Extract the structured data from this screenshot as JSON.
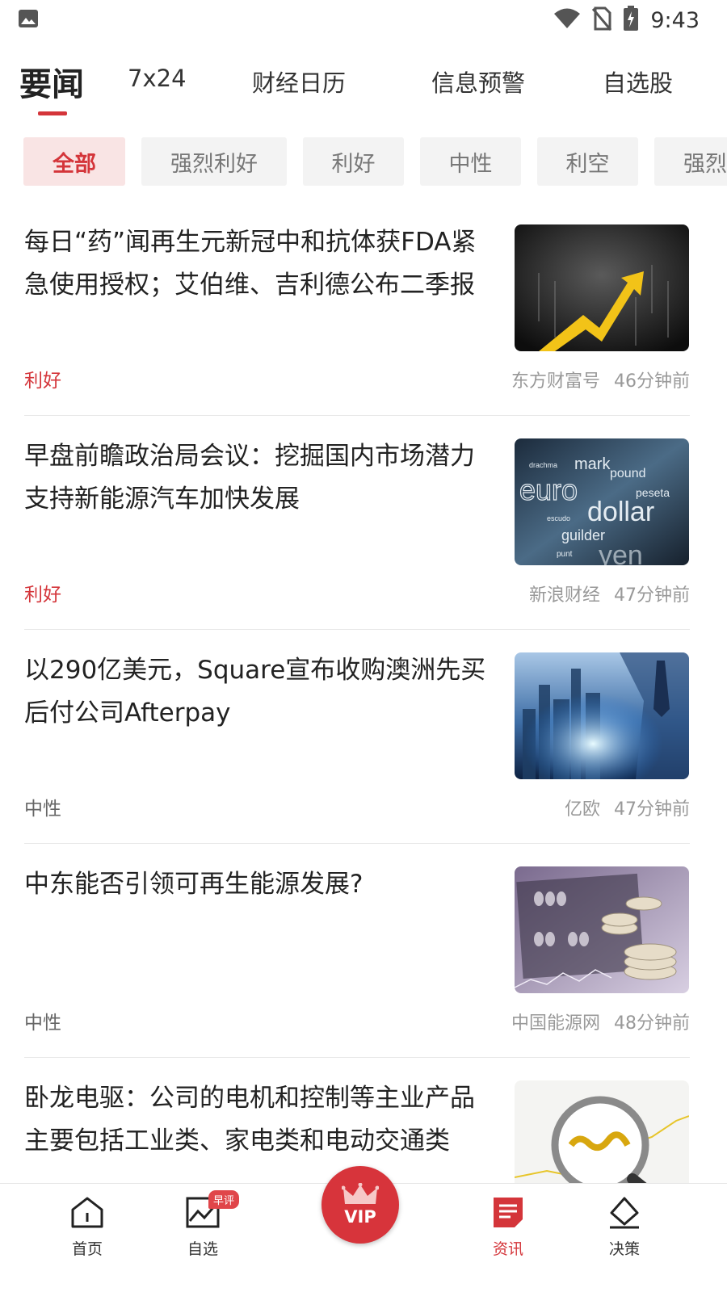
{
  "status_bar": {
    "time": "9:43",
    "icons": [
      "image-notification-icon",
      "wifi-icon",
      "no-sim-icon",
      "battery-charging-icon"
    ]
  },
  "top_tabs": [
    {
      "label": "要闻",
      "active": true
    },
    {
      "label": "7x24",
      "active": false
    },
    {
      "label": "财经日历",
      "active": false
    },
    {
      "label": "信息预警",
      "active": false
    },
    {
      "label": "自选股",
      "active": false
    }
  ],
  "filters": [
    {
      "label": "全部",
      "active": true
    },
    {
      "label": "强烈利好",
      "active": false
    },
    {
      "label": "利好",
      "active": false
    },
    {
      "label": "中性",
      "active": false
    },
    {
      "label": "利空",
      "active": false
    },
    {
      "label": "强烈利空",
      "active": false
    }
  ],
  "news": [
    {
      "title": "每日“药”闻再生元新冠中和抗体获FDA紧急使用授权；艾伯维、吉利德公布二季报",
      "tag": "利好",
      "source": "东方财富号",
      "time": "46分钟前",
      "thumb": "stock-arrow-image"
    },
    {
      "title": "早盘前瞻政治局会议：挖掘国内市场潜力 支持新能源汽车加快发展",
      "tag": "利好",
      "source": "新浪财经",
      "time": "47分钟前",
      "thumb": "currency-words-image",
      "thumb_words": [
        "mark",
        "pound",
        "euro",
        "peseta",
        "dollar",
        "guilder",
        "yen",
        "drachma",
        "escudo",
        "punt"
      ]
    },
    {
      "title": "以290亿美元，Square宣布收购澳洲先买后付公司Afterpay",
      "tag": "中性",
      "source": "亿欧",
      "time": "47分钟前",
      "thumb": "city-business-image"
    },
    {
      "title": "中东能否引领可再生能源发展?",
      "tag": "中性",
      "source": "中国能源网",
      "time": "48分钟前",
      "thumb": "abacus-coins-image"
    },
    {
      "title": "卧龙电驱：公司的电机和控制等主业产品主要包括工业类、家电类和电动交通类",
      "tag": "",
      "source": "",
      "time": "",
      "thumb": "magnifier-chart-image"
    }
  ],
  "bottom_nav": {
    "items": [
      {
        "label": "首页",
        "icon": "home-icon"
      },
      {
        "label": "自选",
        "icon": "chart-icon",
        "badge": "早评"
      },
      {
        "label": "资讯",
        "icon": "news-icon",
        "active": true
      },
      {
        "label": "决策",
        "icon": "decision-icon"
      }
    ],
    "vip_label": "VIP"
  },
  "colors": {
    "accent": "#d4353a",
    "chip_bg": "#f3f3f3",
    "chip_active_bg": "#f9e4e4",
    "text_secondary": "#999999"
  }
}
